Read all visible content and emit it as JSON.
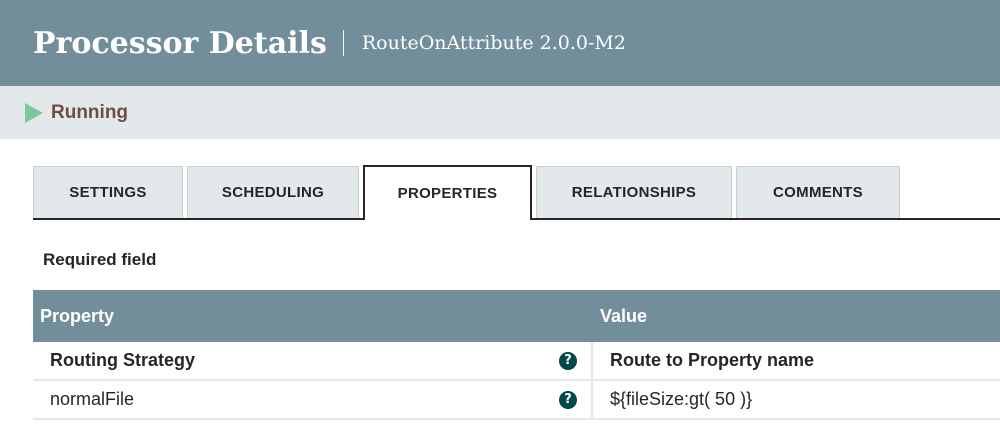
{
  "header": {
    "title": "Processor Details",
    "subtitle": "RouteOnAttribute 2.0.0-M2"
  },
  "status": {
    "label": "Running",
    "icon": "play-icon",
    "icon_color": "#7dc7a0"
  },
  "tabs": [
    {
      "label": "SETTINGS"
    },
    {
      "label": "SCHEDULING"
    },
    {
      "label": "PROPERTIES"
    },
    {
      "label": "RELATIONSHIPS"
    },
    {
      "label": "COMMENTS"
    }
  ],
  "active_tab": "PROPERTIES",
  "required_label": "Required field",
  "table": {
    "columns": [
      "Property",
      "Value"
    ],
    "rows": [
      {
        "property": "Routing Strategy",
        "value": "Route to Property name",
        "required": true,
        "help_icon": "help-icon"
      },
      {
        "property": "normalFile",
        "value": "${fileSize:gt( 50 )}",
        "required": false,
        "help_icon": "help-icon"
      }
    ]
  },
  "colors": {
    "header_bg": "#728e9b",
    "status_bg": "#e3e8eb",
    "status_text": "#6d4b48",
    "help_icon_bg": "#004849"
  }
}
